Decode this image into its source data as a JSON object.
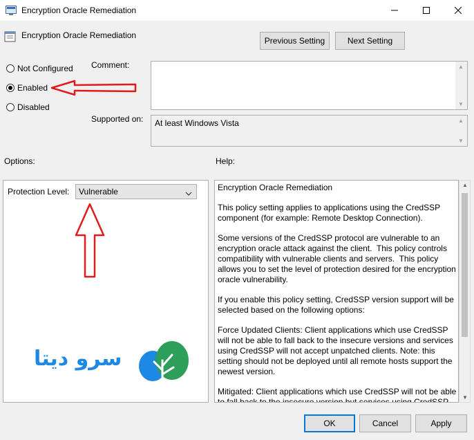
{
  "window": {
    "title": "Encryption Oracle Remediation",
    "controls": {
      "minimize": "—",
      "maximize": "☐",
      "close": "✕"
    }
  },
  "header": {
    "policy_name": "Encryption Oracle Remediation"
  },
  "nav": {
    "previous_label": "Previous Setting",
    "next_label": "Next Setting"
  },
  "state": {
    "options": [
      {
        "label": "Not Configured",
        "selected": false
      },
      {
        "label": "Enabled",
        "selected": true
      },
      {
        "label": "Disabled",
        "selected": false
      }
    ]
  },
  "comment": {
    "label": "Comment:",
    "value": ""
  },
  "supported": {
    "label": "Supported on:",
    "value": "At least Windows Vista"
  },
  "options_panel": {
    "heading": "Options:",
    "protection_label": "Protection Level:",
    "protection_value": "Vulnerable"
  },
  "help_panel": {
    "heading": "Help:",
    "paragraphs": [
      "Encryption Oracle Remediation",
      "This policy setting applies to applications using the CredSSP component (for example: Remote Desktop Connection).",
      "Some versions of the CredSSP protocol are vulnerable to an encryption oracle attack against the client.  This policy controls compatibility with vulnerable clients and servers.  This policy allows you to set the level of protection desired for the encryption oracle vulnerability.",
      "If you enable this policy setting, CredSSP version support will be selected based on the following options:",
      "Force Updated Clients: Client applications which use CredSSP will not be able to fall back to the insecure versions and services using CredSSP will not accept unpatched clients. Note: this setting should not be deployed until all remote hosts support the newest version.",
      "Mitigated: Client applications which use CredSSP will not be able to fall back to the insecure version but services using CredSSP"
    ]
  },
  "watermark": {
    "text": "سرو دیتا",
    "color": "#1e88e5",
    "leaf_color": "#2e9e5b"
  },
  "annotations": {
    "arrow_color": "#e01b1b"
  },
  "footer": {
    "ok_label": "OK",
    "cancel_label": "Cancel",
    "apply_label": "Apply"
  }
}
